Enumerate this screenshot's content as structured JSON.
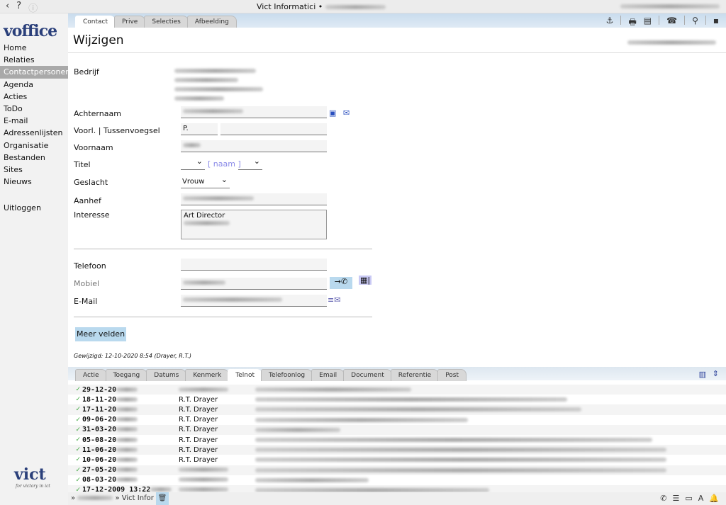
{
  "topbar": {
    "title": "Vict Informatici •",
    "back_icon": "chevron-left-icon",
    "help": "?",
    "info_icon": "info-icon"
  },
  "sidebar": {
    "logo": "voffice",
    "items": [
      {
        "label": "Home"
      },
      {
        "label": "Relaties"
      },
      {
        "label": "Contactpersonen",
        "active": true
      },
      {
        "label": "Agenda"
      },
      {
        "label": "Acties"
      },
      {
        "label": "ToDo"
      },
      {
        "label": "E-mail"
      },
      {
        "label": "Adressenlijsten"
      },
      {
        "label": "Organisatie"
      },
      {
        "label": "Bestanden"
      },
      {
        "label": "Sites"
      },
      {
        "label": "Nieuws"
      }
    ],
    "logout": "Uitloggen",
    "footer_logo": "vict",
    "footer_tagline": "for victory in ict"
  },
  "tabs": [
    {
      "label": "Contact",
      "active": true
    },
    {
      "label": "Prive"
    },
    {
      "label": "Selecties"
    },
    {
      "label": "Afbeelding"
    }
  ],
  "toolbar": {
    "icons": [
      "anchor-icon",
      "print-icon",
      "list-icon",
      "phone-icon",
      "search-icon",
      "save-icon"
    ]
  },
  "page_title": "Wijzigen",
  "form": {
    "bedrijf": "Bedrijf",
    "achternaam": "Achternaam",
    "voorl": "Voorl. | Tussenvoegsel",
    "voorl_value": "P.",
    "voornaam": "Voornaam",
    "titel": "Titel",
    "naam_link": "[ naam ]",
    "geslacht": "Geslacht",
    "geslacht_value": "Vrouw",
    "aanhef": "Aanhef",
    "interesse": "Interesse",
    "interesse_value": "Art Director",
    "telefoon": "Telefoon",
    "mobiel": "Mobiel",
    "email": "E-Mail",
    "meer_velden": "Meer velden",
    "gewijzigd": "Gewijzigd: 12-10-2020 8:54 (Drayer, R.T.)"
  },
  "bottom_tabs": [
    {
      "label": "Actie"
    },
    {
      "label": "Toegang"
    },
    {
      "label": "Datums"
    },
    {
      "label": "Kenmerk"
    },
    {
      "label": "Telnot",
      "active": true
    },
    {
      "label": "Telefoonlog"
    },
    {
      "label": "Email"
    },
    {
      "label": "Document"
    },
    {
      "label": "Referentie"
    },
    {
      "label": "Post"
    }
  ],
  "rows": [
    {
      "date": "29-12-20",
      "name": ""
    },
    {
      "date": "18-11-20",
      "name": "R.T. Drayer"
    },
    {
      "date": "17-11-20",
      "name": "R.T. Drayer"
    },
    {
      "date": "09-06-20",
      "name": "R.T. Drayer"
    },
    {
      "date": "31-03-20",
      "name": "R.T. Drayer"
    },
    {
      "date": "05-08-20",
      "name": "R.T. Drayer"
    },
    {
      "date": "11-06-20",
      "name": "R.T. Drayer"
    },
    {
      "date": "10-06-20",
      "name": "R.T. Drayer"
    },
    {
      "date": "27-05-20",
      "name": ""
    },
    {
      "date": "08-03-20",
      "name": ""
    },
    {
      "date": "17-12-2009 13:22",
      "name": ""
    }
  ],
  "footer": {
    "crumb": "» Vict Infor",
    "icons": [
      "trash-icon",
      "phone-icon",
      "list-icon",
      "monitor-icon",
      "font-icon",
      "bell-icon"
    ]
  },
  "colors": {
    "accent": "#b9d9ee",
    "tabbar": "#c9dced",
    "active_menu": "#a9a9a9"
  }
}
